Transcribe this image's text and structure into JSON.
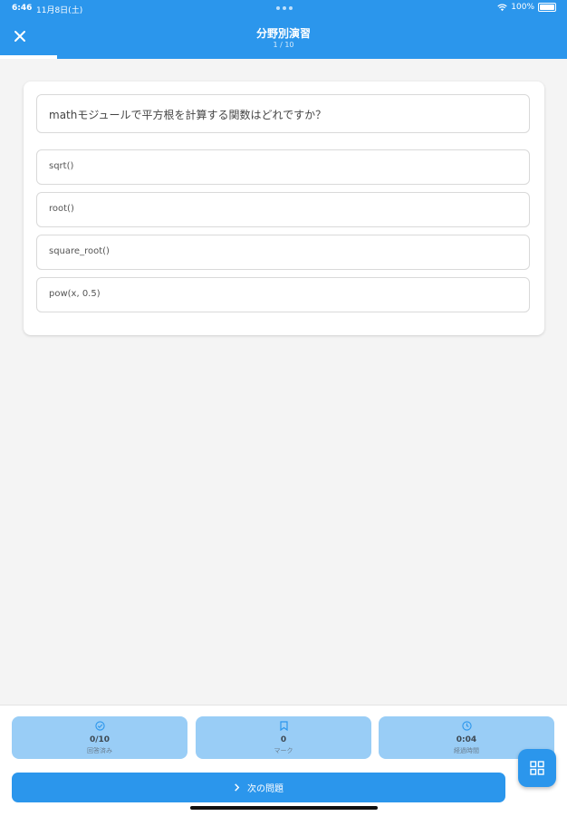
{
  "status_bar": {
    "time": "6:46",
    "date": "11月8日(土)",
    "battery": "100%"
  },
  "header": {
    "title": "分野別演習",
    "subtitle": "1 / 10",
    "progress": 0.1,
    "accent": "#2b96ec"
  },
  "quiz": {
    "question": "mathモジュールで平方根を計算する関数はどれですか？",
    "options": [
      "sqrt()",
      "root()",
      "square_root()",
      "pow(x, 0.5)"
    ]
  },
  "stats": [
    {
      "icon": "check-circle-icon",
      "value": "0/10",
      "label": "回答済み"
    },
    {
      "icon": "bookmark-icon",
      "value": "0",
      "label": "マーク"
    },
    {
      "icon": "clock-icon",
      "value": "0:04",
      "label": "経過時間"
    }
  ],
  "footer": {
    "next_label": "次の問題",
    "next_icon": "chevron-right-icon",
    "grid_icon": "grid-icon"
  }
}
